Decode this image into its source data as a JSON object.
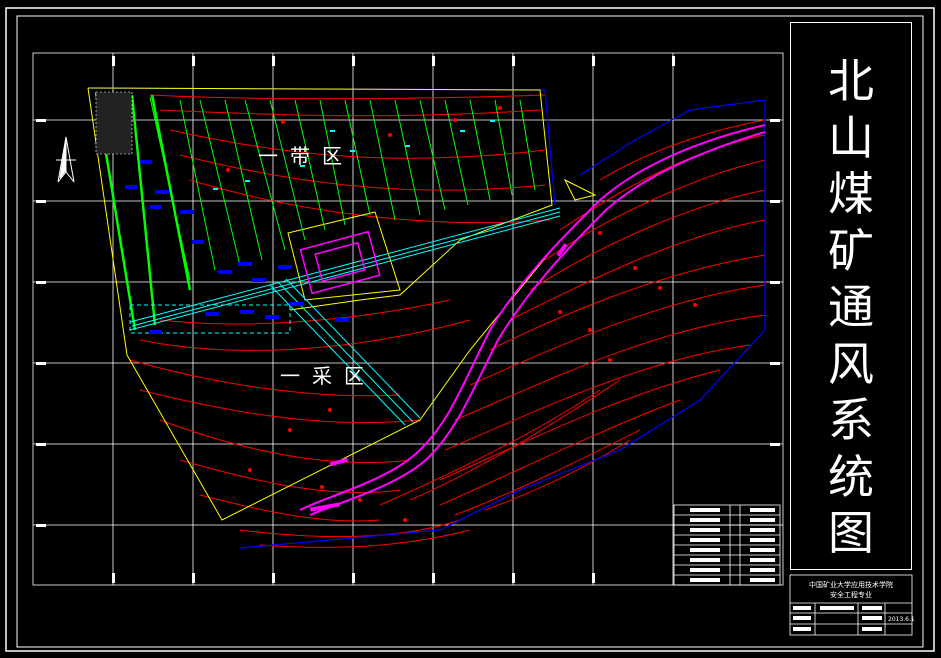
{
  "drawing": {
    "title_chars": [
      "北",
      "山",
      "煤",
      "矿",
      "通",
      "风",
      "系",
      "统",
      "图"
    ],
    "zone_upper": "一带区",
    "zone_lower": "一采区"
  },
  "title_block": {
    "school_line1": "中国矿业大学应用技术学院",
    "school_line2": "安全工程专业",
    "date": "2013.6.1"
  },
  "colors": {
    "frame": "#ffffff",
    "contour": "#ff0000",
    "roadway": "#00ffff",
    "boundary": "#ffff00",
    "slope": "#ff00ff",
    "workings": "#00ff00",
    "machinery": "#0000ff",
    "outer_boundary": "#0000ff"
  },
  "icons": {
    "north_arrow": "north-arrow-icon"
  }
}
